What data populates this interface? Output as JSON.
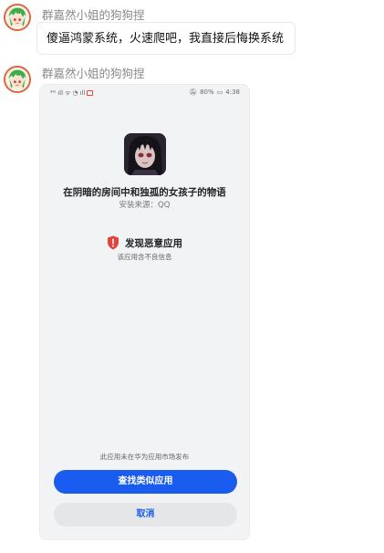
{
  "messages": [
    {
      "sender": "群嘉然小姐的狗狗捏",
      "text": "傻逼鸿蒙系统，火速爬吧，我直接后悔换系统"
    },
    {
      "sender": "群嘉然小姐的狗狗捏",
      "image": {
        "status_bar": {
          "left_glyphs": [
            "⁴ᴳ",
            "ıll",
            "ᯤ",
            "◔",
            "ıll"
          ],
          "battery": "80%",
          "time": "4:38"
        },
        "app_name": "在阴暗的房间中和独孤的女孩子的物语",
        "install_source": "安装来源：QQ",
        "warning_title": "发现恶意应用",
        "warning_desc": "该应用含不良信息",
        "footnote": "此应用未在华为应用市场发布",
        "primary_button": "查找类似应用",
        "secondary_button": "取消"
      }
    }
  ],
  "colors": {
    "accent": "#1a5cf0",
    "warning": "#e0443a",
    "sender_name": "#888888"
  },
  "icons": {
    "avatar": "avatar-green-hair-icon",
    "warning": "shield-warning-icon",
    "app": "app-icon-anime-girl"
  }
}
